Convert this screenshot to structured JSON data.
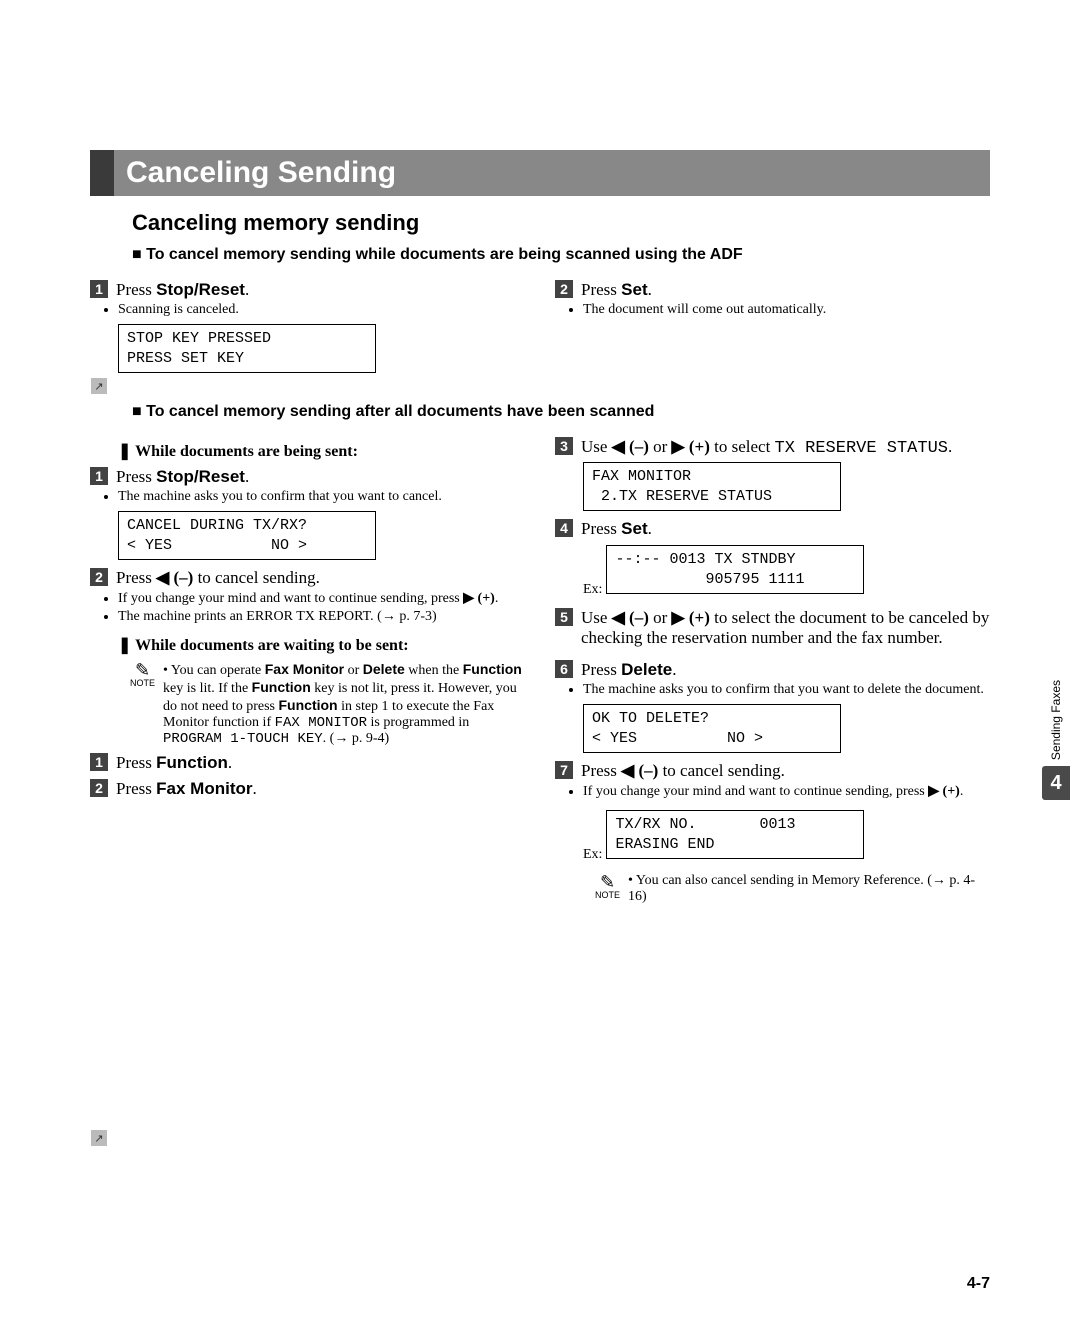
{
  "title": "Canceling Sending",
  "subhead": "Canceling memory sending",
  "section_adf": "To cancel memory sending while documents are being scanned using the ADF",
  "adf": {
    "left": {
      "step1": {
        "pre": "Press ",
        "key": "Stop/Reset",
        "post": "."
      },
      "b1": "Scanning is canceled.",
      "lcd": "STOP KEY PRESSED\nPRESS SET KEY"
    },
    "right": {
      "step2": {
        "pre": "Press ",
        "key": "Set",
        "post": "."
      },
      "b1": "The document will come out automatically."
    }
  },
  "section_after": "To cancel memory sending after all documents have been scanned",
  "after": {
    "left": {
      "dia1": "While documents are being sent:",
      "s1": {
        "pre": "Press ",
        "key": "Stop/Reset",
        "post": "."
      },
      "s1b1": "The machine asks you to confirm that you want to cancel.",
      "lcd1": "CANCEL DURING TX/RX?\n< YES           NO >",
      "s2": {
        "pre": "Press ",
        "btn": "◀ (–)",
        "post": " to cancel sending."
      },
      "s2b1_pre": "If you change your mind and want to continue sending, press ",
      "s2b1_btn": "▶ (+)",
      "s2b1_post": ".",
      "s2b2": "The machine prints an ERROR TX REPORT. (→ p. 7-3)",
      "dia2": "While documents are waiting to be sent:",
      "note1_1": "You can operate ",
      "note1_fm": "Fax Monitor",
      "note1_or": " or ",
      "note1_del": "Delete",
      "note1_2": " when the ",
      "note1_func": "Function",
      "note1_3": " key is lit. If the ",
      "note1_4": " key is not lit, press it. However, you do not need to press ",
      "note1_5": " in step 1 to execute the Fax Monitor function if ",
      "note1_mono": "FAX MONITOR",
      "note1_6": " is programmed in ",
      "note1_mono2": "PROGRAM 1-TOUCH KEY",
      "note1_7": ". (→ p. 9-4)",
      "sA": {
        "pre": "Press ",
        "key": "Function",
        "post": "."
      },
      "sB": {
        "pre": "Press ",
        "key": "Fax Monitor",
        "post": "."
      }
    },
    "right": {
      "s3": {
        "pre": "Use ",
        "b1": "◀ (–)",
        "mid": " or ",
        "b2": "▶ (+)",
        "post": " to select ",
        "mono": "TX RESERVE STATUS",
        "end": "."
      },
      "lcd3": "FAX MONITOR\n 2.TX RESERVE STATUS",
      "s4": {
        "pre": "Press ",
        "key": "Set",
        "post": "."
      },
      "lcd4": "--:-- 0013 TX STNDBY\n          905795 1111",
      "lcd4_ex": "Ex:",
      "s5": {
        "pre": "Use ",
        "b1": "◀ (–)",
        "mid": " or ",
        "b2": "▶ (+)",
        "post": " to select the document to be canceled by checking the reservation number and the fax number."
      },
      "s6": {
        "pre": "Press ",
        "key": "Delete",
        "post": "."
      },
      "s6b1": "The machine asks you to confirm that you want to delete the document.",
      "lcd6": "OK TO DELETE?\n< YES          NO >",
      "s7": {
        "pre": "Press ",
        "btn": "◀ (–)",
        "post": " to cancel sending."
      },
      "s7b1_pre": "If you change your mind and want to continue sending, press ",
      "s7b1_btn": "▶ (+)",
      "s7b1_post": ".",
      "lcd7": "TX/RX NO.       0013\nERASING END",
      "lcd7_ex": "Ex:",
      "note2": "You can also cancel sending in Memory Reference. (→ p. 4-16)"
    }
  },
  "sidebar": {
    "num": "4",
    "label": "Sending Faxes"
  },
  "page_number": "4-7",
  "note_label": "NOTE"
}
